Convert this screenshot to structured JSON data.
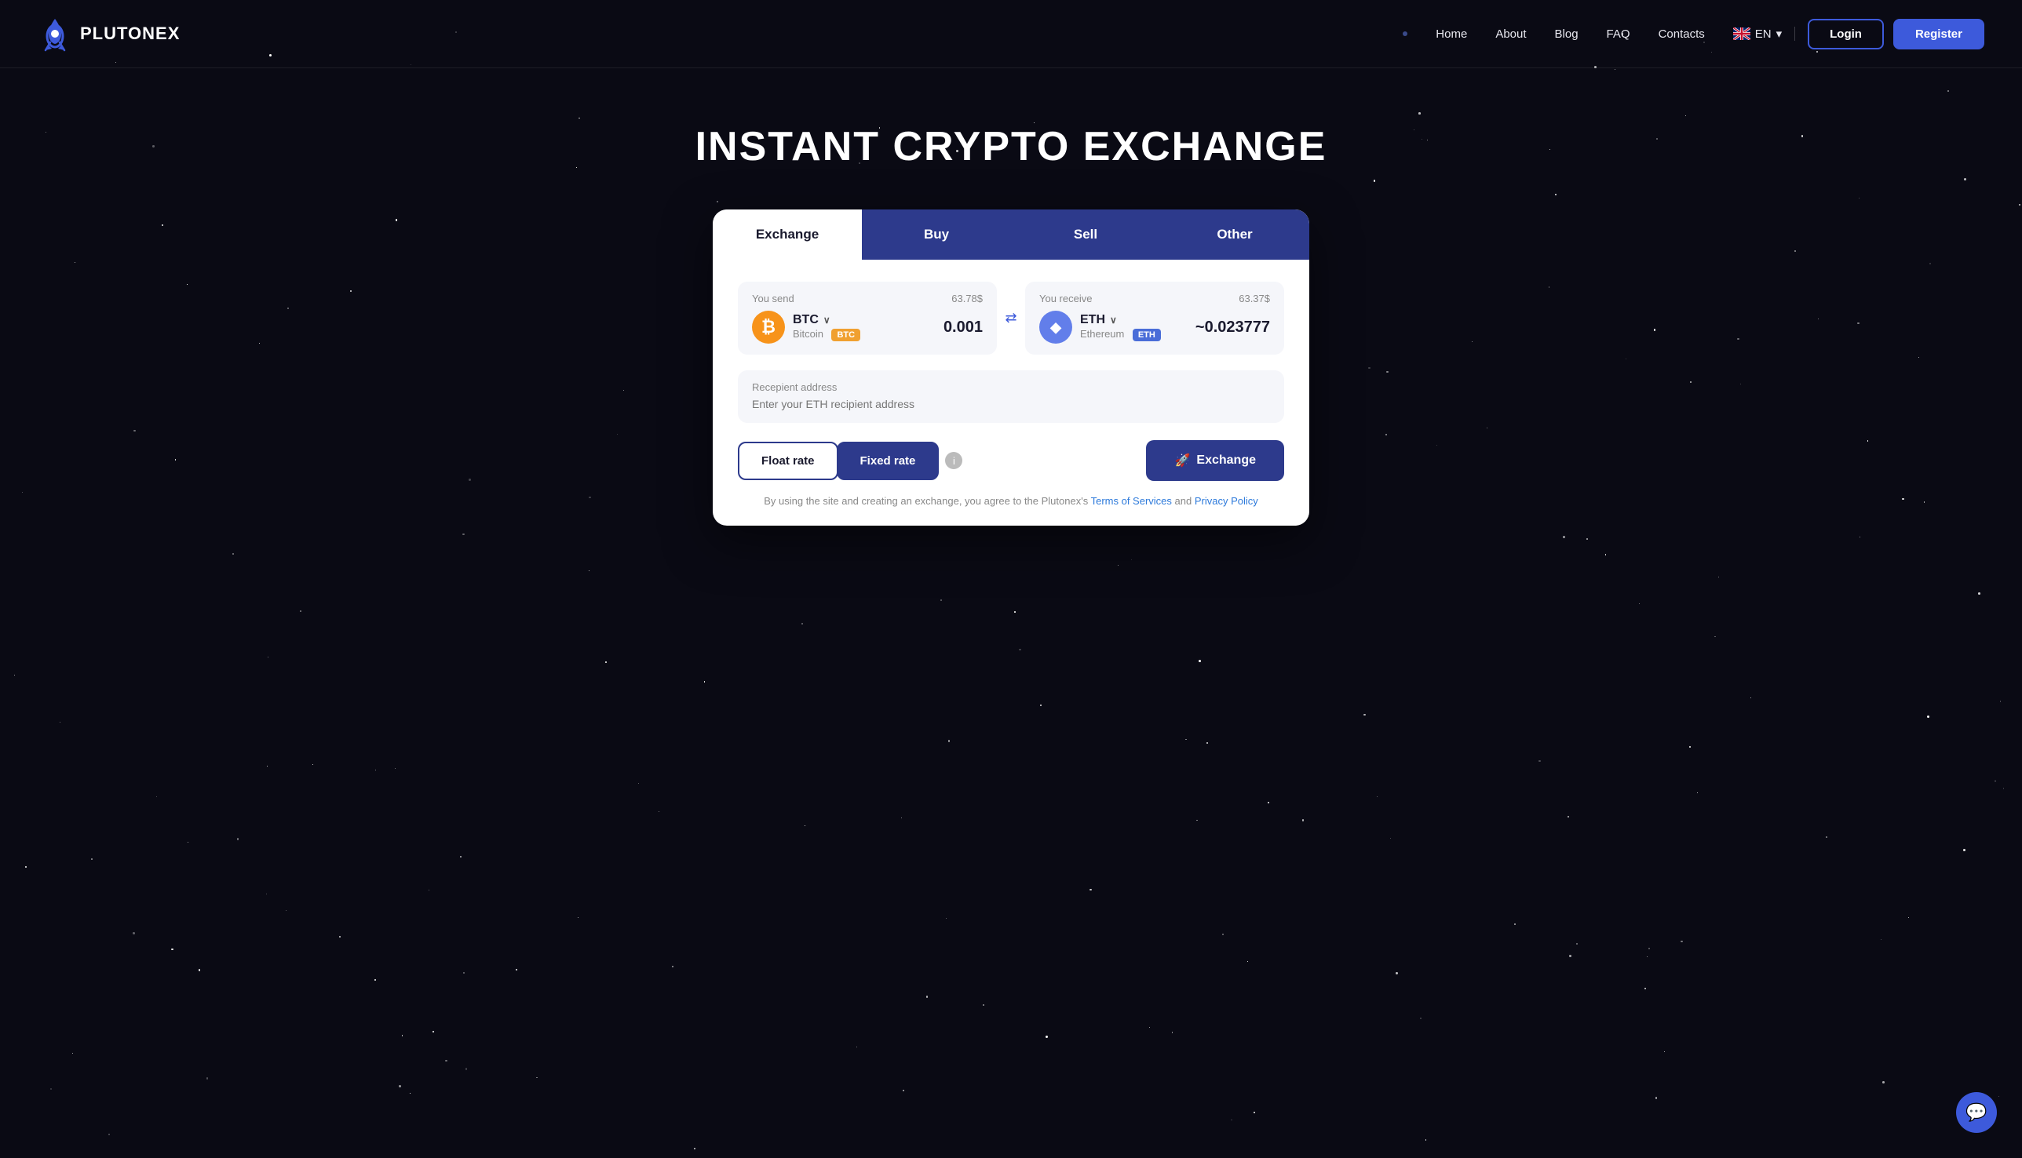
{
  "brand": {
    "name": "PLUTONEX"
  },
  "nav": {
    "dot": "•",
    "links": [
      "Home",
      "About",
      "Blog",
      "FAQ",
      "Contacts"
    ],
    "lang": "EN",
    "login_label": "Login",
    "register_label": "Register"
  },
  "hero": {
    "title": "INSTANT CRYPTO EXCHANGE"
  },
  "tabs": {
    "exchange": "Exchange",
    "buy": "Buy",
    "sell": "Sell",
    "other": "Other"
  },
  "send": {
    "label": "You send",
    "amount_usd": "63.78$",
    "coin": "BTC",
    "coin_chevron": "∨",
    "coin_full": "Bitcoin",
    "coin_badge": "BTC",
    "value": "0.001"
  },
  "receive": {
    "label": "You receive",
    "amount_usd": "63.37$",
    "coin": "ETH",
    "coin_chevron": "∨",
    "coin_full": "Ethereum",
    "coin_badge": "ETH",
    "value": "~0.023777"
  },
  "swap_icon": "⇄",
  "recipient": {
    "label": "Recepient address",
    "placeholder": "Enter your ETH recipient address"
  },
  "rates": {
    "float_label": "Float rate",
    "fixed_label": "Fixed rate"
  },
  "exchange_btn": {
    "icon": "🚀",
    "label": "Exchange"
  },
  "terms": {
    "prefix": "By using the site and creating an exchange, you agree to the Plutonex's",
    "tos_label": "Terms of Services",
    "and": "and",
    "privacy_label": "Privacy Policy"
  },
  "chat": {
    "icon": "💬"
  }
}
